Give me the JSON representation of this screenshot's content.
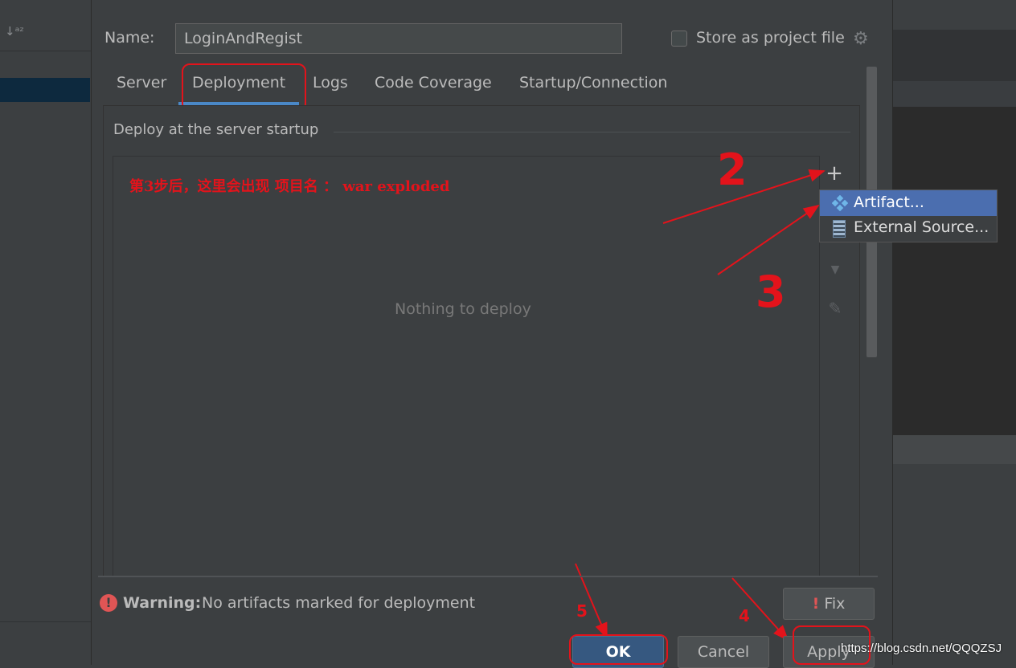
{
  "dialog": {
    "name_label": "Name:",
    "name_value": "LoginAndRegist",
    "store_label": "Store as project file",
    "store_checked": false
  },
  "tabs": [
    {
      "label": "Server",
      "selected": false
    },
    {
      "label": "Deployment",
      "selected": true
    },
    {
      "label": "Logs",
      "selected": false
    },
    {
      "label": "Code Coverage",
      "selected": false
    },
    {
      "label": "Startup/Connection",
      "selected": false
    }
  ],
  "deploy": {
    "section_title": "Deploy at the server startup",
    "empty_text": "Nothing to deploy"
  },
  "popup": {
    "items": [
      {
        "label": "Artifact...",
        "icon": "artifact-icon",
        "highlighted": true
      },
      {
        "label": "External Source...",
        "icon": "archive-icon",
        "highlighted": false
      }
    ]
  },
  "annotations": {
    "note": "第3步后，这里会出现 项目名 ： war exploded",
    "step2": "2",
    "step3": "3",
    "step4": "4",
    "step5": "5",
    "color": "#e3131b"
  },
  "warning": {
    "label": "Warning:",
    "text": "No artifacts marked for deployment",
    "icon": "!"
  },
  "buttons": {
    "fix": "Fix",
    "ok": "OK",
    "cancel": "Cancel",
    "apply": "Apply"
  },
  "watermark": "https://blog.csdn.net/QQQZSJ",
  "colors": {
    "background": "#3c3f41",
    "accent": "#4a88c7",
    "selection": "#4b6eaf"
  }
}
